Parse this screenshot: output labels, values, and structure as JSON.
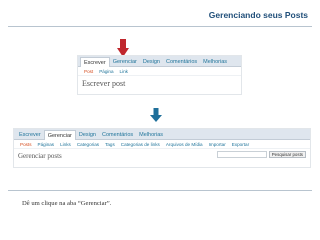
{
  "slide": {
    "title": "Gerenciando seus Posts",
    "caption": "Dê um clique na aba “Gerenciar”."
  },
  "panel_top": {
    "tabs": [
      {
        "label": "Escrever",
        "active": true
      },
      {
        "label": "Gerenciar",
        "active": false
      },
      {
        "label": "Design",
        "active": false
      },
      {
        "label": "Comentários",
        "active": false
      },
      {
        "label": "Melhorias",
        "active": false
      }
    ],
    "subnav": [
      {
        "label": "Post",
        "current": true
      },
      {
        "label": "Página",
        "current": false
      },
      {
        "label": "Link",
        "current": false
      }
    ],
    "heading": "Escrever post"
  },
  "panel_bottom": {
    "tabs": [
      {
        "label": "Escrever",
        "active": false
      },
      {
        "label": "Gerenciar",
        "active": true
      },
      {
        "label": "Design",
        "active": false
      },
      {
        "label": "Comentários",
        "active": false
      },
      {
        "label": "Melhorias",
        "active": false
      }
    ],
    "subnav": [
      {
        "label": "Posts",
        "current": true
      },
      {
        "label": "Páginas",
        "current": false
      },
      {
        "label": "Links",
        "current": false
      },
      {
        "label": "Categorias",
        "current": false
      },
      {
        "label": "Tags",
        "current": false
      },
      {
        "label": "Categorias de links",
        "current": false
      },
      {
        "label": "Arquivos de Mídia",
        "current": false
      },
      {
        "label": "Importar",
        "current": false
      },
      {
        "label": "Exportar",
        "current": false
      }
    ],
    "heading": "Gerenciar posts",
    "search_button": "Pesquisar posts",
    "search_value": ""
  },
  "colors": {
    "title": "#1f4e79",
    "arrow_red": "#c0272d",
    "arrow_blue": "#1f6f9a",
    "link": "#21759b",
    "current": "#d54e21"
  },
  "icons": {
    "arrow_top": "arrow-down-icon",
    "arrow_middle": "arrow-down-icon"
  }
}
